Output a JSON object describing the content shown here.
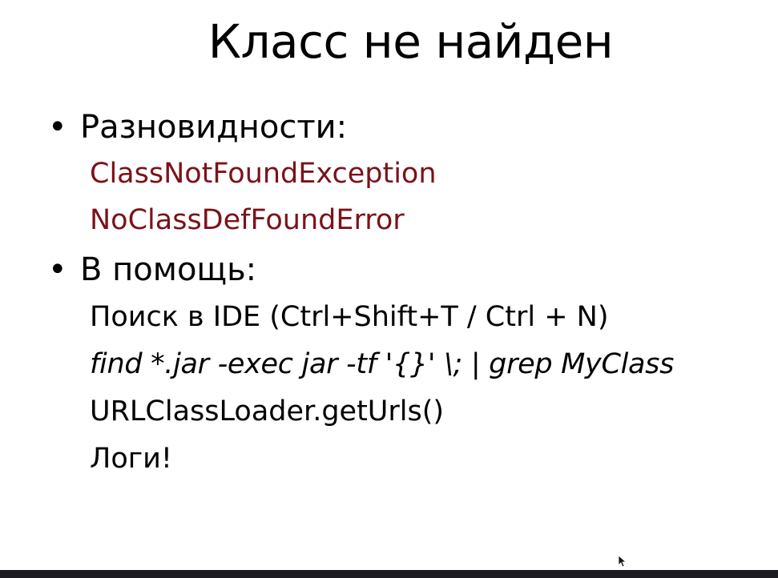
{
  "slide": {
    "title": "Класс не найден",
    "sections": [
      {
        "bullet": "•",
        "heading": "Разновидности:",
        "items": [
          "ClassNotFoundException",
          "NoClassDefFoundError"
        ]
      },
      {
        "bullet": "•",
        "heading": "В помощь:",
        "items": [
          "Поиск в IDE (Ctrl+Shift+T / Ctrl + N)",
          "find *.jar -exec jar -tf '{}' \\; | grep MyClass",
          "URLClassLoader.getUrls()",
          "Логи!"
        ]
      }
    ]
  },
  "colors": {
    "text": "#000000",
    "exception_red": "#7b1219",
    "background": "#ffffff"
  },
  "icons": {
    "cursor": "mouse-pointer-icon"
  }
}
